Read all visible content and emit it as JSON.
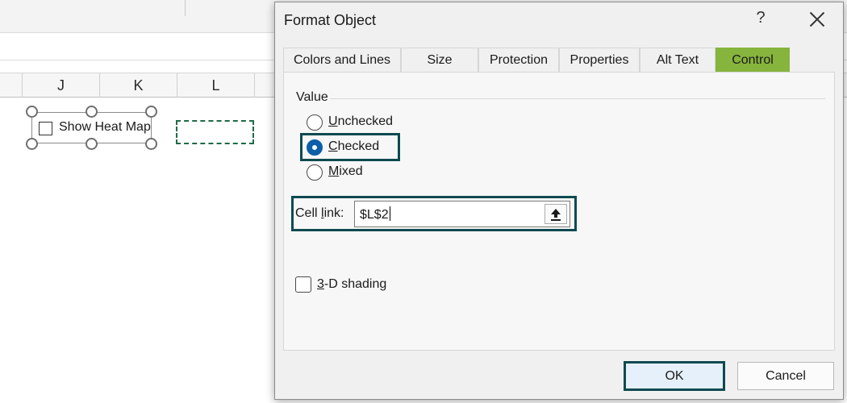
{
  "spreadsheet": {
    "columns": [
      "J",
      "K",
      "L"
    ],
    "checkbox_label": "Show Heat Map"
  },
  "dialog": {
    "title": "Format Object",
    "help_label": "?",
    "tabs": [
      {
        "label": "Colors and Lines",
        "active": false
      },
      {
        "label": "Size",
        "active": false
      },
      {
        "label": "Protection",
        "active": false
      },
      {
        "label": "Properties",
        "active": false
      },
      {
        "label": "Alt Text",
        "active": false
      },
      {
        "label": "Control",
        "active": true
      }
    ],
    "value_group": {
      "label": "Value",
      "options": [
        {
          "label": "Unchecked",
          "selected": false
        },
        {
          "label": "Checked",
          "selected": true
        },
        {
          "label": "Mixed",
          "selected": false
        }
      ]
    },
    "cell_link": {
      "label_pre": "Cell ",
      "label_ul": "l",
      "label_post": "ink:",
      "value": "$L$2"
    },
    "shading": {
      "label_ul": "3",
      "label_post": "-D shading",
      "checked": false
    },
    "buttons": {
      "ok": "OK",
      "cancel": "Cancel"
    }
  },
  "colors": {
    "active_tab": "#86b43d",
    "highlight_border": "#0c4a50",
    "radio_selected": "#0c5ea8",
    "cell_marquee": "#1e6b46"
  }
}
